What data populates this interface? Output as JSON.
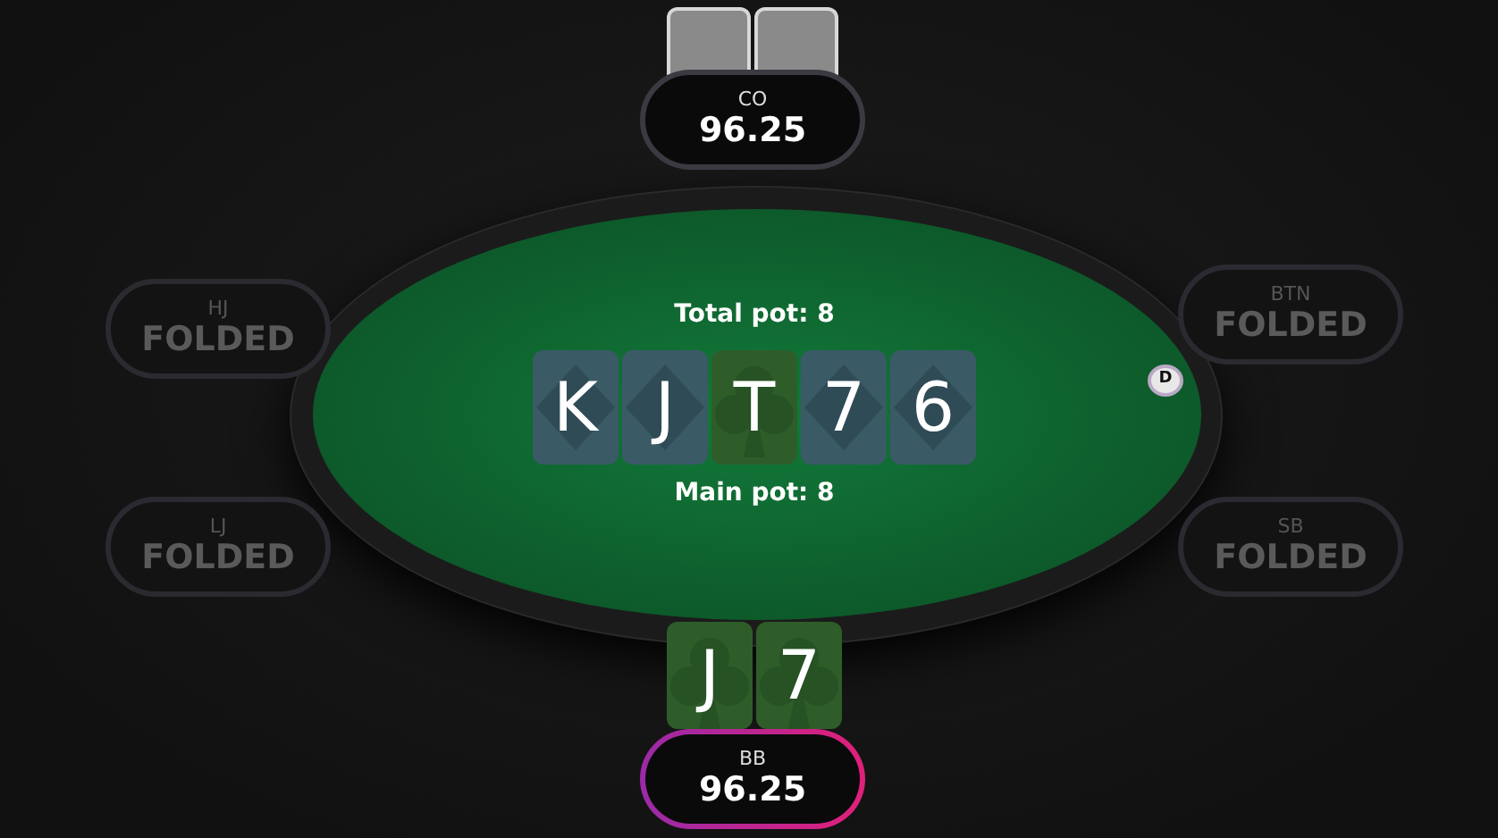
{
  "table": {
    "total_pot": "Total pot: 8",
    "main_pot": "Main pot: 8",
    "dealer_button": "D",
    "board": [
      {
        "rank": "K",
        "kind": "diamond"
      },
      {
        "rank": "J",
        "kind": "diamond"
      },
      {
        "rank": "T",
        "kind": "club"
      },
      {
        "rank": "7",
        "kind": "diamond"
      },
      {
        "rank": "6",
        "kind": "diamond"
      }
    ]
  },
  "seats": [
    {
      "position": "CO",
      "stack": "96.25",
      "folded": false,
      "to_act": false,
      "cards": [
        {
          "kind": "back"
        },
        {
          "kind": "back"
        }
      ]
    },
    {
      "position": "HJ",
      "stack": "FOLDED",
      "folded": true,
      "to_act": false
    },
    {
      "position": "BTN",
      "stack": "FOLDED",
      "folded": true,
      "to_act": false
    },
    {
      "position": "LJ",
      "stack": "FOLDED",
      "folded": true,
      "to_act": false
    },
    {
      "position": "SB",
      "stack": "FOLDED",
      "folded": true,
      "to_act": false
    },
    {
      "position": "BB",
      "stack": "96.25",
      "folded": false,
      "to_act": true,
      "cards": [
        {
          "kind": "club",
          "rank": "J"
        },
        {
          "kind": "club",
          "rank": "7"
        }
      ]
    }
  ]
}
